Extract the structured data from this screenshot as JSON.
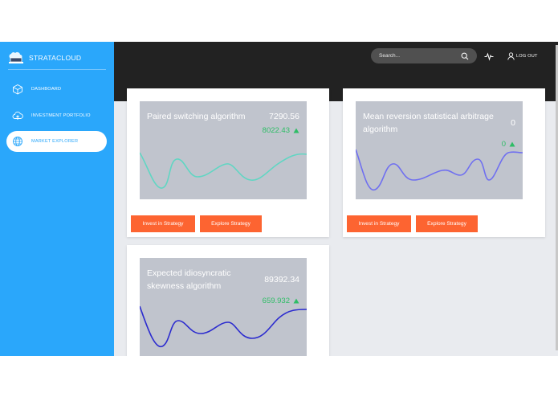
{
  "brand": {
    "name": "STRATACLOUD",
    "logo_icon": "laptop-cloud-icon"
  },
  "sidebar": {
    "items": [
      {
        "label": "DASHBOARD",
        "icon": "cube-icon",
        "active": false
      },
      {
        "label": "INVESTMENT PORTFOLIO",
        "icon": "cloud-upload-icon",
        "active": false
      },
      {
        "label": "MARKET EXPLORER",
        "icon": "globe-icon",
        "active": true
      }
    ]
  },
  "topbar": {
    "search_placeholder": "Search...",
    "logout_label": "LOG OUT"
  },
  "colors": {
    "sidebar": "#2aa7fb",
    "topbar": "#222222",
    "button": "#fd6431",
    "positive": "#2ebd66",
    "chart_panel": "#c0c4cd",
    "content_bg": "#e9ebef"
  },
  "strategies": [
    {
      "name": "Paired switching algorithm",
      "value": "7290.56",
      "change": "8022.43",
      "trend": "up",
      "line_color": "#60d6c3",
      "invest_label": "Invest in Strategy",
      "explore_label": "Explore Strategy"
    },
    {
      "name": "Mean reversion statistical arbitrage algorithm",
      "value": "0",
      "change": "0",
      "trend": "up",
      "line_color": "#6f6ff0",
      "invest_label": "Invest in Strategy",
      "explore_label": "Explore Strategy"
    },
    {
      "name": "Expected idiosyncratic skewness algorithm",
      "value": "89392.34",
      "change": "659.932",
      "trend": "up",
      "line_color": "#2c2ccf",
      "invest_label": "",
      "explore_label": ""
    }
  ]
}
